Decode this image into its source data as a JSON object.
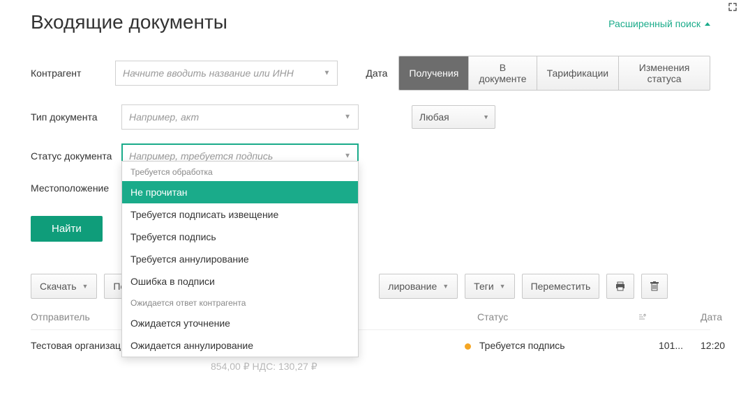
{
  "header": {
    "title": "Входящие документы",
    "advanced_search": "Расширенный поиск"
  },
  "filters": {
    "counterparty_label": "Контрагент",
    "counterparty_placeholder": "Начните вводить название или ИНН",
    "doctype_label": "Тип документа",
    "doctype_placeholder": "Например, акт",
    "docstatus_label": "Статус документа",
    "docstatus_placeholder": "Например, требуется подпись",
    "location_label": "Местоположение"
  },
  "date_filter": {
    "label": "Дата",
    "tabs": [
      "Получения",
      "В документе",
      "Тарификации",
      "Изменения статуса"
    ],
    "active_index": 0,
    "any_label": "Любая"
  },
  "status_dropdown": {
    "groups": [
      {
        "title": "Требуется обработка",
        "items": [
          "Не прочитан",
          "Требуется подписать извещение",
          "Требуется подпись",
          "Требуется аннулирование",
          "Ошибка в подписи"
        ]
      },
      {
        "title": "Ожидается ответ контрагента",
        "items": [
          "Ожидается уточнение",
          "Ожидается аннулирование"
        ]
      }
    ],
    "selected": "Не прочитан"
  },
  "actions": {
    "search": "Найти"
  },
  "toolbar": {
    "download": "Скачать",
    "sign_prefix": "По",
    "annul_suffix": "лирование",
    "tags": "Теги",
    "move": "Переместить"
  },
  "table": {
    "head": {
      "sender": "Отправитель",
      "status": "Статус",
      "date": "Дата"
    },
    "rows": [
      {
        "sender": "Тестовая организац",
        "amount_line": "854,00 ₽  НДС: 130,27 ₽",
        "status": "Требуется подпись",
        "num": "101...",
        "date": "12:20"
      }
    ]
  }
}
